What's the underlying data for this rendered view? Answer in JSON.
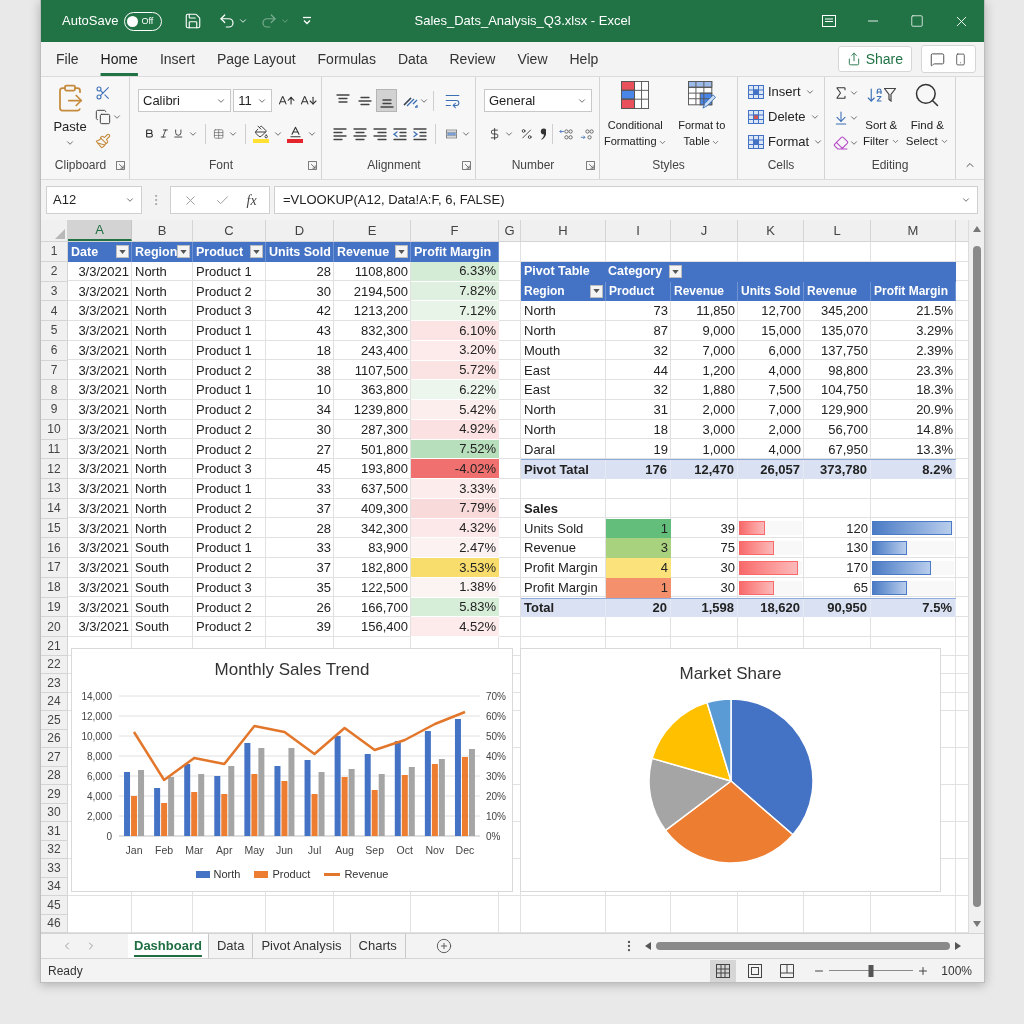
{
  "title_bar": {
    "autosave": {
      "label": "AutoSave",
      "on": false,
      "state_text": "Off"
    },
    "undo": {
      "disabled": false
    },
    "redo": {
      "disabled": true
    },
    "title": "Sales_Dats_Analysis_Q3.xlsx - Excel"
  },
  "ribbon_tabs": [
    {
      "label": "File",
      "selected": false
    },
    {
      "label": "Home",
      "selected": true
    },
    {
      "label": "Insert",
      "selected": false
    },
    {
      "label": "Page Layout",
      "selected": false
    },
    {
      "label": "Formulas",
      "selected": false
    },
    {
      "label": "Data",
      "selected": false
    },
    {
      "label": "Review",
      "selected": false
    },
    {
      "label": "View",
      "selected": false
    },
    {
      "label": "Help",
      "selected": false
    }
  ],
  "share_button": {
    "label": "Share"
  },
  "ribbon": {
    "clipboard": {
      "paste_label": "Paste",
      "group_label": "Clipboard"
    },
    "font": {
      "font_name": "Calibri",
      "font_size": "11",
      "group_label": "Font"
    },
    "alignment": {
      "vertical_align": [
        {
          "selected": false
        },
        {
          "selected": false
        },
        {
          "selected": true
        }
      ],
      "group_label": "Alignment"
    },
    "number": {
      "format": "General",
      "group_label": "Number"
    },
    "styles": {
      "buttons": [
        "Conditional Formatting",
        "Format to Table"
      ],
      "group_label": "Styles"
    },
    "cells": {
      "buttons": [
        "Insert",
        "Delete",
        "Format"
      ],
      "group_label": "Cells"
    },
    "editing": {
      "buttons": [
        "Sort & Filter",
        "Find & Select"
      ],
      "group_label": "Editing"
    }
  },
  "formula_bar": {
    "name_box": "A12",
    "function_label": "fx",
    "formula": "=VLOOKUP(A12, Data!A:F, 6, FALSE)"
  },
  "columns": [
    {
      "label": "A",
      "selected": true
    },
    {
      "label": "B",
      "selected": false
    },
    {
      "label": "C",
      "selected": false
    },
    {
      "label": "D",
      "selected": false
    },
    {
      "label": "E",
      "selected": false
    },
    {
      "label": "F",
      "selected": false
    },
    {
      "label": "G",
      "selected": false
    },
    {
      "label": "H",
      "selected": false
    },
    {
      "label": "I",
      "selected": false
    },
    {
      "label": "J",
      "selected": false
    },
    {
      "label": "K",
      "selected": false
    },
    {
      "label": "L",
      "selected": false
    },
    {
      "label": "M",
      "selected": false
    }
  ],
  "row_numbers": [
    "1",
    "2",
    "3",
    "4",
    "5",
    "6",
    "7",
    "8",
    "9",
    "10",
    "11",
    "12",
    "13",
    "14",
    "15",
    "16",
    "17",
    "18",
    "19",
    "20",
    "21",
    "22",
    "23",
    "24",
    "25",
    "26",
    "27",
    "28",
    "29",
    "30",
    "31",
    "32",
    "33",
    "34",
    "45",
    "46"
  ],
  "data_table": {
    "headers": [
      {
        "label": "Date",
        "filter": true
      },
      {
        "label": "Region",
        "filter": true
      },
      {
        "label": "Product",
        "filter": true
      },
      {
        "label": "Units Sold",
        "filter": false
      },
      {
        "label": "Revenue",
        "filter": true
      },
      {
        "label": "Profit Margin",
        "filter": false
      }
    ],
    "rows": [
      {
        "cells": [
          "3/3/2021",
          "North",
          "Product 1",
          "28",
          "1108,800",
          "6.33%"
        ],
        "color": "#d4ecd6"
      },
      {
        "cells": [
          "3/3/2021",
          "North",
          "Product 2",
          "30",
          "2194,500",
          "7.82%"
        ],
        "color": "#dff0e0"
      },
      {
        "cells": [
          "3/3/2021",
          "North",
          "Product 3",
          "42",
          "1213,200",
          "7.12%"
        ],
        "color": "#e8f4e8"
      },
      {
        "cells": [
          "3/3/2021",
          "North",
          "Product 1",
          "43",
          "832,300",
          "6.10%"
        ],
        "color": "#fce4e4"
      },
      {
        "cells": [
          "3/3/2021",
          "North",
          "Product 1",
          "18",
          "243,400",
          "3.20%"
        ],
        "color": "#fdeaea"
      },
      {
        "cells": [
          "3/3/2021",
          "North",
          "Product 2",
          "38",
          "1107,500",
          "5.72%"
        ],
        "color": "#fce3e3"
      },
      {
        "cells": [
          "3/3/2021",
          "North",
          "Product 1",
          "10",
          "363,800",
          "6.22%"
        ],
        "color": "#ecf6ec"
      },
      {
        "cells": [
          "3/3/2021",
          "North",
          "Product 2",
          "34",
          "1239,800",
          "5.42%"
        ],
        "color": "#fdeeee"
      },
      {
        "cells": [
          "3/3/2021",
          "North",
          "Product 2",
          "30",
          "287,300",
          "4.92%"
        ],
        "color": "#fbe1e1"
      },
      {
        "cells": [
          "3/3/2021",
          "North",
          "Product 2",
          "27",
          "501,800",
          "7.52%"
        ],
        "color": "#b8dfbc"
      },
      {
        "cells": [
          "3/3/2021",
          "North",
          "Product 3",
          "45",
          "193,800",
          "-4.02%"
        ],
        "color": "#f07070"
      },
      {
        "cells": [
          "3/3/2021",
          "North",
          "Product 1",
          "33",
          "637,500",
          "3.33%"
        ],
        "color": "#fdecec"
      },
      {
        "cells": [
          "3/3/2021",
          "North",
          "Product 2",
          "37",
          "409,300",
          "7.79%"
        ],
        "color": "#f9dada"
      },
      {
        "cells": [
          "3/3/2021",
          "North",
          "Product 2",
          "28",
          "342,300",
          "4.32%"
        ],
        "color": "#fce8e8"
      },
      {
        "cells": [
          "3/3/2021",
          "South",
          "Product 1",
          "33",
          "83,900",
          "2.47%"
        ],
        "color": "#fdf2f2"
      },
      {
        "cells": [
          "3/3/2021",
          "South",
          "Product 2",
          "37",
          "182,800",
          "3.53%"
        ],
        "color": "#f8dd6c"
      },
      {
        "cells": [
          "3/3/2021",
          "South",
          "Product 3",
          "35",
          "122,500",
          "1.38%"
        ],
        "color": "#fcf3f3"
      },
      {
        "cells": [
          "3/3/2021",
          "South",
          "Product 2",
          "26",
          "166,700",
          "5.83%"
        ],
        "color": "#d6eed7"
      },
      {
        "cells": [
          "3/3/2021",
          "South",
          "Product 2",
          "39",
          "156,400",
          "4.52%"
        ],
        "color": "#fdeaea"
      }
    ]
  },
  "pivot_table": {
    "title": "Pivot Table",
    "filter_label": "Category",
    "filter": true,
    "headers": [
      {
        "label": "Region",
        "filter": true
      },
      {
        "label": "Product",
        "filter": false
      },
      {
        "label": "Revenue",
        "filter": false
      },
      {
        "label": "Units Sold",
        "filter": false
      },
      {
        "label": "Revenue",
        "filter": false
      },
      {
        "label": "Profit Margin",
        "filter": false
      }
    ],
    "rows": [
      [
        "North",
        "73",
        "11,850",
        "12,700",
        "345,200",
        "21.5%"
      ],
      [
        "North",
        "87",
        "9,000",
        "15,000",
        "135,070",
        "3.29%"
      ],
      [
        "Mouth",
        "32",
        "7,000",
        "6,000",
        "137,750",
        "2.39%"
      ],
      [
        "East",
        "44",
        "1,200",
        "4,000",
        "98,800",
        "23.3%"
      ],
      [
        "East",
        "32",
        "1,880",
        "7,500",
        "104,750",
        "18.3%"
      ],
      [
        "North",
        "31",
        "2,000",
        "7,000",
        "129,900",
        "20.9%"
      ],
      [
        "North",
        "18",
        "3,000",
        "2,000",
        "56,700",
        "14.8%"
      ],
      [
        "Daral",
        "19",
        "1,000",
        "4,000",
        "67,950",
        "13.3%"
      ]
    ],
    "total": [
      "Pivot Tatal",
      "176",
      "12,470",
      "26,057",
      "373,780",
      "8.2%"
    ]
  },
  "sales_summary": {
    "title": "Sales",
    "rows": [
      {
        "label": "Units Sold",
        "column_i": "1",
        "color": "#63be7b",
        "column_j": "39",
        "column_k_bar": {
          "level": 0.42
        },
        "column_l": "120",
        "column_m_bar": {
          "level": 0.97
        }
      },
      {
        "label": "Revenue",
        "column_i": "3",
        "color": "#a9d27f",
        "column_j": "75",
        "column_k_bar": {
          "level": 0.55
        },
        "column_l": "130",
        "column_m_bar": {
          "level": 0.43
        }
      },
      {
        "label": "Profit Margin",
        "column_i": "4",
        "color": "#fbe27a",
        "column_j": "30",
        "column_k_bar": {
          "level": 0.94
        },
        "column_l": "170",
        "column_m_bar": {
          "level": 0.72
        }
      },
      {
        "label": "Profit Margin",
        "column_i": "1",
        "color": "#f4906c",
        "column_j": "30",
        "column_k_bar": {
          "level": 0.55
        },
        "column_l": "65",
        "column_m_bar": {
          "level": 0.43
        }
      }
    ],
    "total": [
      "Total",
      "20",
      "1,598",
      "18,620",
      "90,950",
      "7.5%"
    ]
  },
  "line_chart": {
    "chart_data": {
      "type": "bar",
      "title": "Monthly Sales Trend",
      "categories": [
        "Jan",
        "Feb",
        "Mar",
        "Apr",
        "May",
        "Jun",
        "Jul",
        "Aug",
        "Sep",
        "Oct",
        "Nov",
        "Dec"
      ],
      "series": [
        {
          "name": "North",
          "color": "#4472c4",
          "values": [
            6400,
            4800,
            7200,
            6000,
            9300,
            7000,
            7600,
            10000,
            8200,
            9500,
            10500,
            11700
          ]
        },
        {
          "name": "Product",
          "color": "#ed7d31",
          "values": [
            4000,
            3300,
            4400,
            4200,
            6200,
            5500,
            4200,
            5900,
            4600,
            6100,
            7200,
            7900
          ]
        },
        {
          "color": "#a5a5a5",
          "values": [
            6600,
            5900,
            6200,
            7000,
            8800,
            8800,
            6400,
            6700,
            6200,
            6900,
            7700,
            8700
          ]
        },
        {
          "name": "Revenue",
          "color": "#e2762a",
          "type": "line",
          "axis": "y2",
          "values": [
            0.52,
            0.28,
            0.39,
            0.36,
            0.55,
            0.52,
            0.41,
            0.54,
            0.43,
            0.48,
            0.56,
            0.62
          ]
        }
      ],
      "ylim": [
        0,
        14000
      ],
      "yticks": [
        {
          "value": 0,
          "label": "0"
        },
        {
          "value": 2000,
          "label": "2,000"
        },
        {
          "value": 4000,
          "label": "4,000"
        },
        {
          "value": 6000,
          "label": "6,000"
        },
        {
          "value": 8000,
          "label": "8,000"
        },
        {
          "value": 10000,
          "label": "10,000"
        },
        {
          "value": 12000,
          "label": "12,000"
        },
        {
          "value": 14000,
          "label": "14,000"
        }
      ],
      "y2lim": [
        0,
        0.7
      ],
      "y2ticks": [
        {
          "value": 0,
          "label": "0%"
        },
        {
          "value": 0.1,
          "label": "10%"
        },
        {
          "value": 0.2,
          "label": "20%"
        },
        {
          "value": 0.3,
          "label": "30%"
        },
        {
          "value": 0.4,
          "label": "40%"
        },
        {
          "value": 0.5,
          "label": "50%"
        },
        {
          "value": 0.6,
          "label": "60%"
        },
        {
          "value": 0.7,
          "label": "70%"
        }
      ],
      "grid": true,
      "legend": "bottom"
    }
  },
  "pie_chart": {
    "title": "Market Share"
  },
  "sheet_tabs": [
    {
      "label": "Dashboard",
      "selected": true
    },
    {
      "label": "Data",
      "selected": false
    },
    {
      "label": "Pivot Analysis",
      "selected": false
    },
    {
      "label": "Charts",
      "selected": false
    }
  ],
  "status_bar": {
    "status": "Ready",
    "view_modes": [
      {
        "selected": true
      },
      {
        "selected": false
      },
      {
        "selected": false
      }
    ],
    "zoom_slider": {
      "level": 0.5
    },
    "zoom": "100%"
  }
}
